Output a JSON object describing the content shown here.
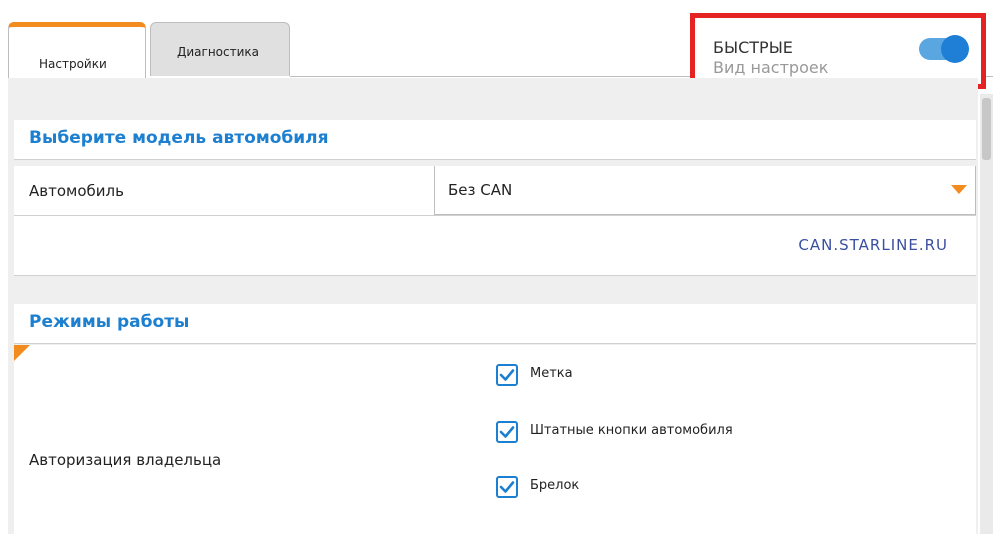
{
  "tabs": [
    {
      "label": "Настройки",
      "active": true
    },
    {
      "label": "Диагностика",
      "active": false
    }
  ],
  "quick_mode": {
    "title": "БЫСТРЫЕ",
    "subtitle": "Вид настроек",
    "enabled": true
  },
  "section_car": {
    "title": "Выберите модель автомобиля",
    "car_label": "Автомобиль",
    "car_value": "Без CAN",
    "link": "CAN.STARLINE.RU"
  },
  "section_modes": {
    "title": "Режимы работы",
    "auth_label": "Авторизация владельца",
    "options": [
      {
        "label": "Метка",
        "checked": true
      },
      {
        "label": "Штатные кнопки автомобиля",
        "checked": true
      },
      {
        "label": "Брелок",
        "checked": true
      }
    ]
  },
  "colors": {
    "accent": "#1c7fcf",
    "tab_marker": "#f28c1e",
    "highlight_frame": "#e52323"
  }
}
